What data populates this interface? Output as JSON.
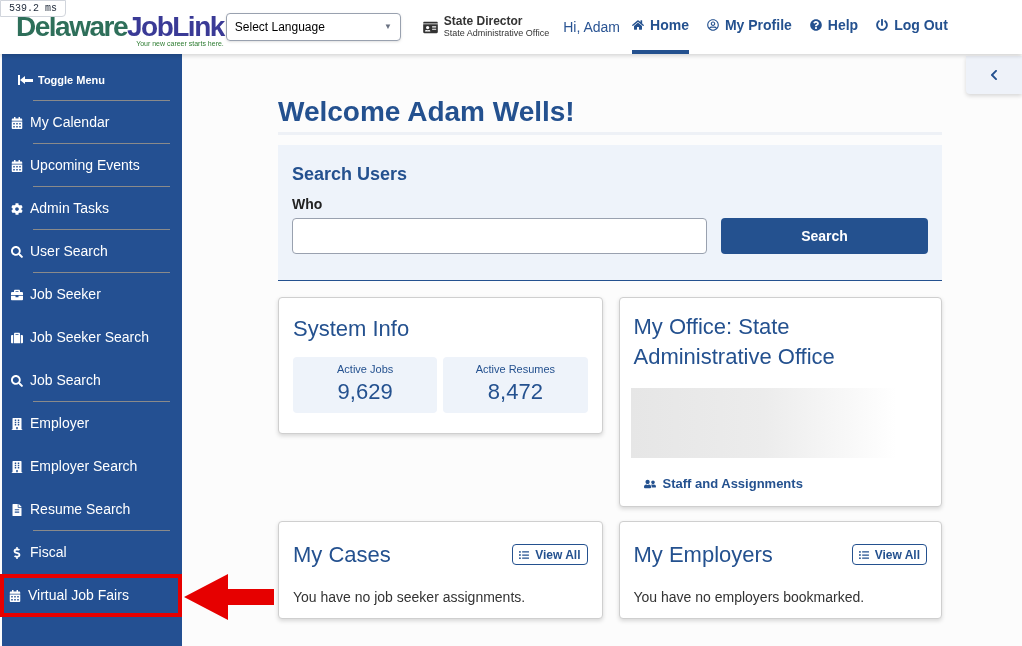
{
  "timer_badge": "539.2 ms",
  "logo": {
    "part_1": "Delaware",
    "part_2": "JobLink",
    "tagline": "Your new career starts here."
  },
  "language_select": {
    "value": "Select Language",
    "arrow": "▼"
  },
  "role": {
    "title": "State Director",
    "office": "State Administrative Office"
  },
  "greeting": "Hi, Adam",
  "nav": [
    {
      "label": "Home",
      "selected": true
    },
    {
      "label": "My Profile",
      "selected": false
    },
    {
      "label": "Help",
      "selected": false
    },
    {
      "label": "Log Out",
      "selected": false
    }
  ],
  "sidebar": {
    "toggle": "Toggle Menu",
    "items": [
      {
        "label": "My Calendar",
        "divider": true,
        "highlighted": false
      },
      {
        "label": "Upcoming Events",
        "divider": true,
        "highlighted": false
      },
      {
        "label": "Admin Tasks",
        "divider": true,
        "highlighted": false
      },
      {
        "label": "User Search",
        "divider": true,
        "highlighted": false
      },
      {
        "label": "Job Seeker",
        "divider": false,
        "highlighted": false
      },
      {
        "label": "Job Seeker Search",
        "divider": false,
        "highlighted": false
      },
      {
        "label": "Job Search",
        "divider": true,
        "highlighted": false
      },
      {
        "label": "Employer",
        "divider": false,
        "highlighted": false
      },
      {
        "label": "Employer Search",
        "divider": false,
        "highlighted": false
      },
      {
        "label": "Resume Search",
        "divider": true,
        "highlighted": false
      },
      {
        "label": "Fiscal",
        "divider": false,
        "highlighted": false
      },
      {
        "label": "Virtual Job Fairs",
        "divider": false,
        "highlighted": true
      }
    ]
  },
  "welcome": "Welcome Adam Wells!",
  "search_users": {
    "title": "Search Users",
    "label": "Who",
    "button": "Search"
  },
  "system_info": {
    "title": "System Info",
    "stats": [
      {
        "label": "Active Jobs",
        "value": "9,629"
      },
      {
        "label": "Active Resumes",
        "value": "8,472"
      }
    ]
  },
  "my_office": {
    "title": "My Office: State Administrative Office",
    "link": "Staff and Assignments"
  },
  "my_cases": {
    "title": "My Cases",
    "button": "View All",
    "message": "You have no job seeker assignments."
  },
  "my_employers": {
    "title": "My Employers",
    "button": "View All",
    "message": "You have no employers bookmarked."
  }
}
